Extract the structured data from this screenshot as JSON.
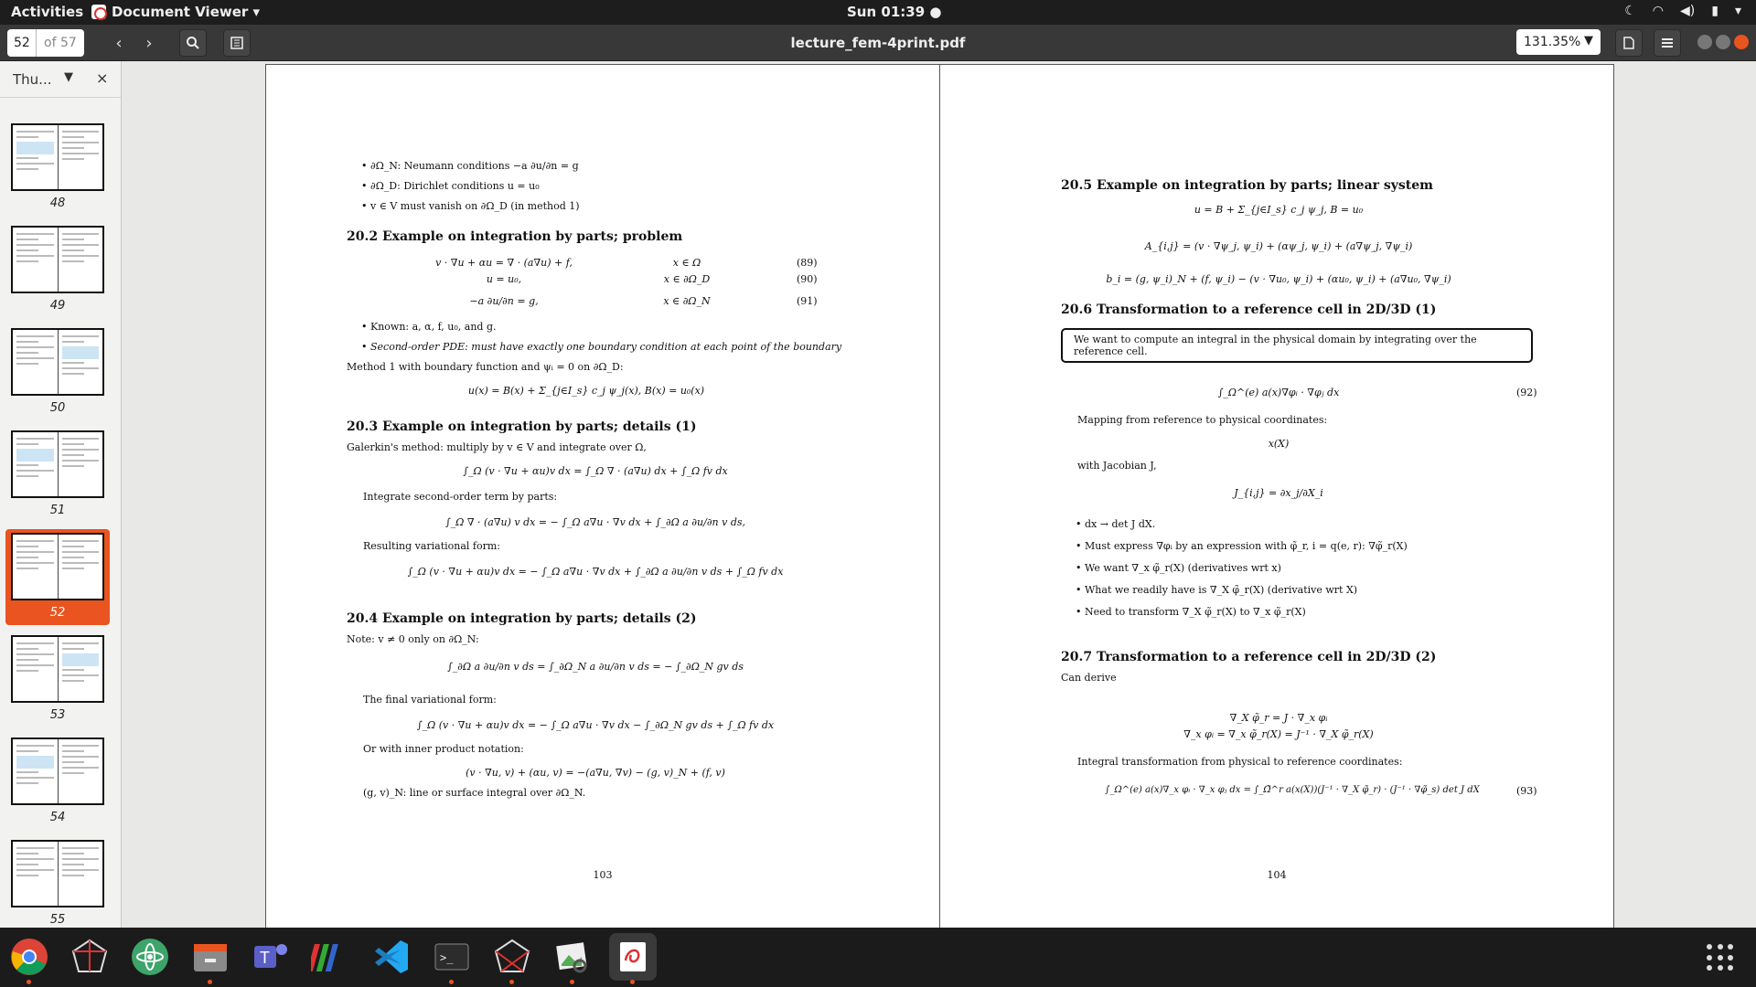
{
  "topbar": {
    "activities": "Activities",
    "app_name": "Document Viewer ▾",
    "clock": "Sun 01:39 ●"
  },
  "header": {
    "page_current": "52",
    "page_total": "of 57",
    "title": "lecture_fem-4print.pdf",
    "zoom": "131.35%"
  },
  "sidebar": {
    "mode_label": "Thu...",
    "thumbnails": [
      "48",
      "49",
      "50",
      "51",
      "52",
      "53",
      "54",
      "55"
    ],
    "active_page": "52"
  },
  "left_page": {
    "bullets_top": [
      "∂Ω_N: Neumann conditions −a ∂u/∂n = g",
      "∂Ω_D: Dirichlet conditions u = u₀",
      "v ∈ V must vanish on ∂Ω_D (in method 1)"
    ],
    "s20_2": {
      "title": "20.2  Example on integration by parts; problem",
      "eq89": "v · ∇u + αu = ∇ · (a∇u) + f,",
      "eq89_cond": "x ∈ Ω",
      "eq89_num": "(89)",
      "eq90": "u = u₀,",
      "eq90_cond": "x ∈ ∂Ω_D",
      "eq90_num": "(90)",
      "eq91": "−a ∂u/∂n = g,",
      "eq91_cond": "x ∈ ∂Ω_N",
      "eq91_num": "(91)",
      "bullet1": "Known: a, α, f, u₀, and g.",
      "bullet2": "Second-order PDE: must have exactly one boundary condition at each point of the boundary",
      "method": "Method 1 with boundary function and ψᵢ = 0 on ∂Ω_D:",
      "eq_u": "u(x) = B(x) + Σ_{j∈I_s} c_j ψ_j(x),    B(x) = u₀(x)"
    },
    "s20_3": {
      "title": "20.3  Example on integration by parts; details (1)",
      "text1": "Galerkin's method: multiply by v ∈ V and integrate over Ω,",
      "eq1": "∫_Ω (v · ∇u + αu)v dx = ∫_Ω ∇ · (a∇u) dx + ∫_Ω fv dx",
      "text2": "Integrate second-order term by parts:",
      "eq2": "∫_Ω ∇ · (a∇u) v dx = − ∫_Ω a∇u · ∇v dx + ∫_∂Ω a ∂u/∂n v ds,",
      "text3": "Resulting variational form:",
      "eq3": "∫_Ω (v · ∇u + αu)v dx = − ∫_Ω a∇u · ∇v dx + ∫_∂Ω a ∂u/∂n v ds + ∫_Ω fv dx"
    },
    "s20_4": {
      "title": "20.4  Example on integration by parts; details (2)",
      "text1": "Note: v ≠ 0 only on ∂Ω_N:",
      "eq1": "∫_∂Ω a ∂u/∂n v ds = ∫_∂Ω_N a ∂u/∂n v ds = − ∫_∂Ω_N gv ds",
      "text2": "The final variational form:",
      "eq2": "∫_Ω (v · ∇u + αu)v dx = − ∫_Ω a∇u · ∇v dx − ∫_∂Ω_N gv ds + ∫_Ω fv dx",
      "text3": "Or with inner product notation:",
      "eq3": "(v · ∇u, v) + (αu, v) = −(a∇u, ∇v) − (g, v)_N + (f, v)",
      "text4": "(g, v)_N: line or surface integral over ∂Ω_N."
    },
    "page_number": "103"
  },
  "right_page": {
    "s20_5": {
      "title": "20.5  Example on integration by parts; linear system",
      "eq1": "u = B + Σ_{j∈I_s} c_j ψ_j,    B = u₀",
      "eq2": "A_{i,j} = (v · ∇ψ_j, ψ_i) + (αψ_j, ψ_i) + (a∇ψ_j, ∇ψ_i)",
      "eq3": "b_i = (g, ψ_i)_N + (f, ψ_i) − (v · ∇u₀, ψ_i) + (αu₀, ψ_i) + (a∇u₀, ∇ψ_i)"
    },
    "s20_6": {
      "title": "20.6  Transformation to a reference cell in 2D/3D (1)",
      "box": "We want to compute an integral in the physical domain by integrating over the reference cell.",
      "eq92": "∫_Ω^(e) a(x)∇φᵢ · ∇φⱼ dx",
      "eq92_num": "(92)",
      "text1": "Mapping from reference to physical coordinates:",
      "eq_map": "x(X)",
      "text2": "with Jacobian J,",
      "eq_j": "J_{i,j} = ∂x_j/∂X_i",
      "bullets": [
        "dx → det J dX.",
        "Must express ∇φᵢ by an expression with φ̃_r, i = q(e, r): ∇φ̃_r(X)",
        "We want ∇_x φ̃_r(X) (derivatives wrt x)",
        "What we readily have is ∇_X φ̃_r(X) (derivative wrt X)",
        "Need to transform ∇_X φ̃_r(X) to ∇_x φ̃_r(X)"
      ]
    },
    "s20_7": {
      "title": "20.7  Transformation to a reference cell in 2D/3D (2)",
      "text1": "Can derive",
      "eq1": "∇_X φ̃_r = J · ∇_x φᵢ",
      "eq2": "∇_x φᵢ = ∇_x φ̃_r(X) = J⁻¹ · ∇_X φ̃_r(X)",
      "text2": "Integral transformation from physical to reference coordinates:",
      "eq93": "∫_Ω^(e) a(x)∇_x φᵢ · ∇_x φⱼ dx = ∫_Ω̃^r a(x(X))(J⁻¹ · ∇_X φ̃_r) · (J⁻¹ · ∇φ̃_s) det J dX",
      "eq93_num": "(93)"
    },
    "page_number": "104"
  },
  "dock": {
    "apps": [
      "chrome-icon",
      "network-app-icon",
      "atom-icon",
      "files-icon",
      "teams-icon",
      "books-icon",
      "vscode-icon",
      "terminal-icon",
      "network-app-2-icon",
      "image-viewer-icon",
      "document-viewer-icon"
    ]
  },
  "colors": {
    "accent": "#e95420",
    "topbar": "#1d1d1d",
    "headerbar": "#383838"
  }
}
